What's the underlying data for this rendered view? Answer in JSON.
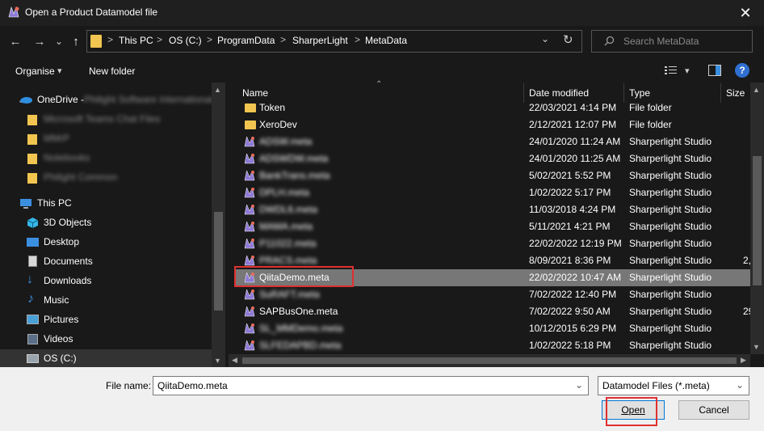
{
  "window": {
    "title": "Open a Product Datamodel file",
    "close_glyph": "✕"
  },
  "nav": {
    "back": "←",
    "forward": "→",
    "recent": "⌄",
    "up": "↑"
  },
  "address": {
    "crumbs": [
      "This PC",
      "OS (C:)",
      "ProgramData",
      "SharperLight",
      "MetaData"
    ],
    "separator": ">",
    "dropdown": "⌄",
    "refresh": "↻"
  },
  "search": {
    "placeholder": "Search MetaData"
  },
  "toolbar": {
    "organise": "Organise",
    "organise_caret": "▾",
    "new_folder": "New folder",
    "view_caret": "▾",
    "help": "?"
  },
  "navpane": {
    "onedrive": "OneDrive - ",
    "onedrive_blurred": "Philight Software International",
    "blurred_items": [
      "Microsoft Teams Chat Files",
      "MMrP",
      "Notebooks",
      "Philight Common"
    ],
    "this_pc": "This PC",
    "items": [
      "3D Objects",
      "Desktop",
      "Documents",
      "Downloads",
      "Music",
      "Pictures",
      "Videos",
      "OS (C:)"
    ]
  },
  "columns": {
    "name": "Name",
    "date_modified": "Date modified",
    "type": "Type",
    "size": "Size"
  },
  "files": [
    {
      "name": "Token",
      "date": "22/03/2021 4:14 PM",
      "type": "File folder",
      "size": "",
      "kind": "folder",
      "blurred": false
    },
    {
      "name": "XeroDev",
      "date": "2/12/2021 12:07 PM",
      "type": "File folder",
      "size": "",
      "kind": "folder",
      "blurred": false
    },
    {
      "name": "ADSW.meta",
      "date": "24/01/2020 11:24 AM",
      "type": "Sharperlight Studio",
      "size": "",
      "kind": "meta",
      "blurred": true
    },
    {
      "name": "ADSWDW.meta",
      "date": "24/01/2020 11:25 AM",
      "type": "Sharperlight Studio",
      "size": "",
      "kind": "meta",
      "blurred": true
    },
    {
      "name": "BankTrans.meta",
      "date": "5/02/2021 5:52 PM",
      "type": "Sharperlight Studio",
      "size": "",
      "kind": "meta",
      "blurred": true
    },
    {
      "name": "DPLH.meta",
      "date": "1/02/2022 5:17 PM",
      "type": "Sharperlight Studio",
      "size": "",
      "kind": "meta",
      "blurred": true
    },
    {
      "name": "DWDL6.meta",
      "date": "11/03/2018 4:24 PM",
      "type": "Sharperlight Studio",
      "size": "",
      "kind": "meta",
      "blurred": true
    },
    {
      "name": "MAMA.meta",
      "date": "5/11/2021 4:21 PM",
      "type": "Sharperlight Studio",
      "size": "",
      "kind": "meta",
      "blurred": true
    },
    {
      "name": "P11022.meta",
      "date": "22/02/2022 12:19 PM",
      "type": "Sharperlight Studio",
      "size": "",
      "kind": "meta",
      "blurred": true
    },
    {
      "name": "PRACS.meta",
      "date": "8/09/2021 8:36 PM",
      "type": "Sharperlight Studio",
      "size": "2,",
      "kind": "meta",
      "blurred": true
    },
    {
      "name": "QiitaDemo.meta",
      "date": "22/02/2022 10:47 AM",
      "type": "Sharperlight Studio",
      "size": "",
      "kind": "meta",
      "blurred": false,
      "selected": true
    },
    {
      "name": "SuRAFT.meta",
      "date": "7/02/2022 12:40 PM",
      "type": "Sharperlight Studio",
      "size": "",
      "kind": "meta",
      "blurred": true
    },
    {
      "name": "SAPBusOne.meta",
      "date": "7/02/2022 9:50 AM",
      "type": "Sharperlight Studio",
      "size": "29,",
      "kind": "meta",
      "blurred": false
    },
    {
      "name": "SL_MMDemo.meta",
      "date": "10/12/2015 6:29 PM",
      "type": "Sharperlight Studio",
      "size": "",
      "kind": "meta",
      "blurred": true
    },
    {
      "name": "SLFEDAPBD.meta",
      "date": "1/02/2022 5:18 PM",
      "type": "Sharperlight Studio",
      "size": "",
      "kind": "meta",
      "blurred": true
    }
  ],
  "bottom": {
    "filename_label": "File name:",
    "filename_value": "QiitaDemo.meta",
    "filter_value": "Datamodel Files (*.meta)",
    "combo_caret": "⌄",
    "open": "Open",
    "cancel": "Cancel"
  },
  "colors": {
    "highlight": "#e03030",
    "selection": "#777777",
    "folder": "#f1c550"
  }
}
